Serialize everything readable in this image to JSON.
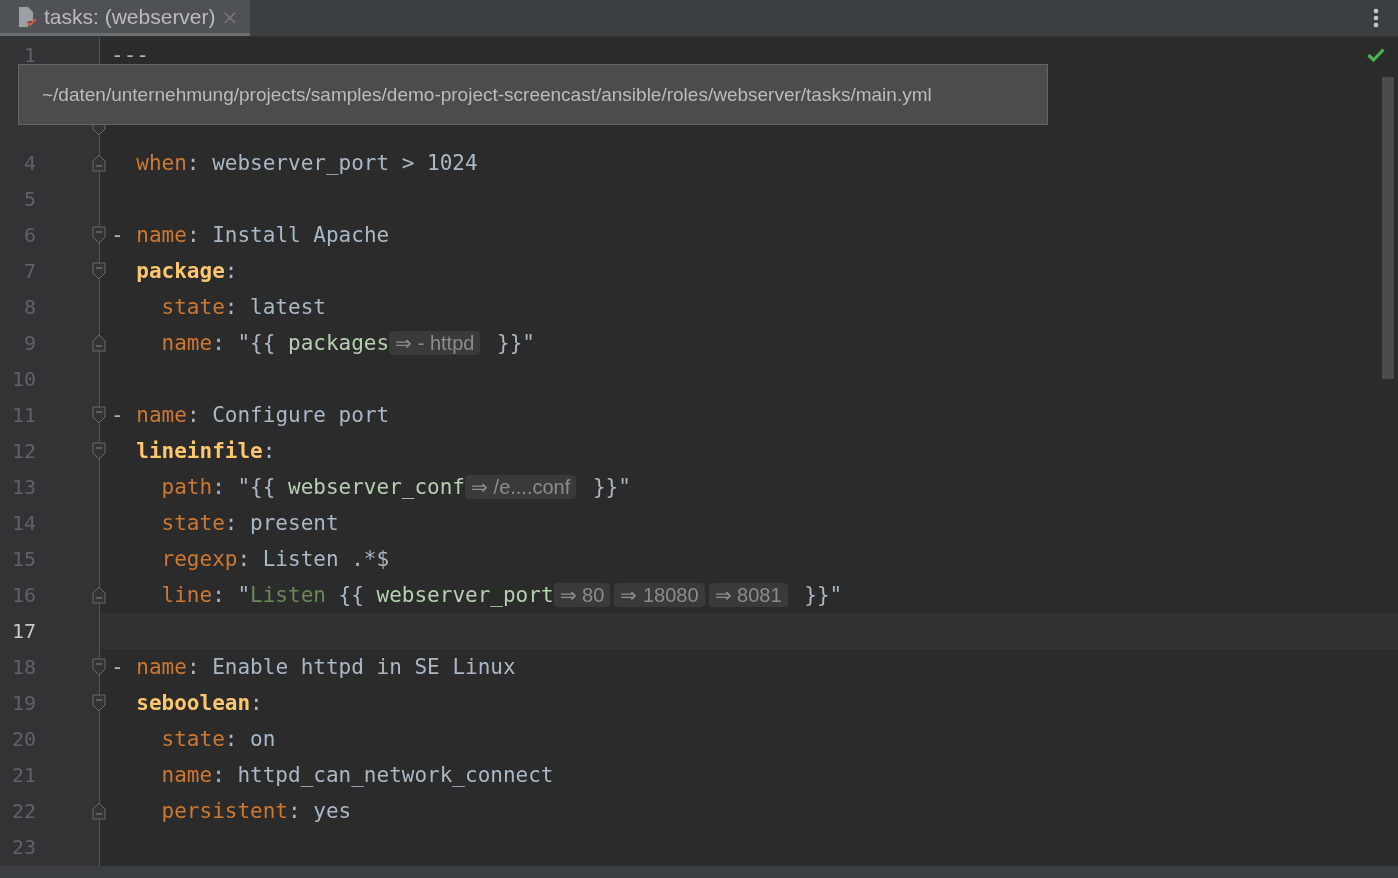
{
  "tab": {
    "title": "tasks: (webserver)",
    "close": "×",
    "selected": true
  },
  "tooltip": {
    "text": "~/daten/unternehmung/projects/samples/demo-project-screencast/ansible/roles/webserver/tasks/main.yml"
  },
  "lines": [
    {
      "number": "1",
      "current": false,
      "kind": "top",
      "tokens": [
        {
          "kind": "plain",
          "text": "---"
        }
      ]
    },
    {
      "kind": "top"
    },
    {
      "kind": "top",
      "fold_start": true
    },
    {
      "number": "4",
      "current": false,
      "kind": "item",
      "fold_end": true,
      "tokens": [
        {
          "kind": "key",
          "text": "when"
        },
        {
          "kind": "plain",
          "text": ": webserver_port > 1024"
        }
      ]
    },
    {
      "number": "5",
      "current": false,
      "kind": "top"
    },
    {
      "number": "6",
      "current": false,
      "kind": "top",
      "fold_start": true,
      "tokens": [
        {
          "kind": "plain",
          "text": "- "
        },
        {
          "kind": "key",
          "text": "name"
        },
        {
          "kind": "plain",
          "text": ": Install Apache"
        }
      ]
    },
    {
      "number": "7",
      "current": false,
      "kind": "item",
      "fold_start": true,
      "tokens": [
        {
          "kind": "section",
          "text": "package"
        },
        {
          "kind": "plain",
          "text": ":"
        }
      ]
    },
    {
      "number": "8",
      "current": false,
      "kind": "nested",
      "tokens": [
        {
          "kind": "key",
          "text": "state"
        },
        {
          "kind": "plain",
          "text": ": latest"
        }
      ]
    },
    {
      "number": "9",
      "current": false,
      "kind": "nested",
      "fold_end": true,
      "tokens": [
        {
          "kind": "key",
          "text": "name"
        },
        {
          "kind": "plain",
          "text": ": \"{{ "
        },
        {
          "kind": "var",
          "text": "packages"
        },
        {
          "kind": "hint",
          "text": "⇒ - httpd"
        },
        {
          "kind": "brace",
          "text": " }}\""
        }
      ]
    },
    {
      "number": "10",
      "current": false,
      "kind": "top"
    },
    {
      "number": "11",
      "current": false,
      "kind": "top",
      "fold_start": true,
      "tokens": [
        {
          "kind": "plain",
          "text": "- "
        },
        {
          "kind": "key",
          "text": "name"
        },
        {
          "kind": "plain",
          "text": ": Configure port"
        }
      ]
    },
    {
      "number": "12",
      "current": false,
      "kind": "item",
      "fold_start": true,
      "tokens": [
        {
          "kind": "section",
          "text": "lineinfile"
        },
        {
          "kind": "plain",
          "text": ":"
        }
      ]
    },
    {
      "number": "13",
      "current": false,
      "kind": "nested",
      "tokens": [
        {
          "kind": "key",
          "text": "path"
        },
        {
          "kind": "plain",
          "text": ": \"{{ "
        },
        {
          "kind": "var",
          "text": "webserver_conf"
        },
        {
          "kind": "hint",
          "text": "⇒ /e....conf"
        },
        {
          "kind": "brace",
          "text": " }}\""
        }
      ]
    },
    {
      "number": "14",
      "current": false,
      "kind": "nested",
      "tokens": [
        {
          "kind": "key",
          "text": "state"
        },
        {
          "kind": "plain",
          "text": ": present"
        }
      ]
    },
    {
      "number": "15",
      "current": false,
      "kind": "nested",
      "tokens": [
        {
          "kind": "key",
          "text": "regexp"
        },
        {
          "kind": "plain",
          "text": ": Listen .*$"
        }
      ]
    },
    {
      "number": "16",
      "current": false,
      "kind": "nested",
      "fold_end": true,
      "tokens": [
        {
          "kind": "key",
          "text": "line"
        },
        {
          "kind": "plain",
          "text": ": \""
        },
        {
          "kind": "string",
          "text": "Listen "
        },
        {
          "kind": "brace",
          "text": "{{ "
        },
        {
          "kind": "var",
          "text": "webserver_port"
        },
        {
          "kind": "hint",
          "text": "⇒ 80"
        },
        {
          "kind": "hint",
          "text": "⇒ 18080"
        },
        {
          "kind": "hint",
          "text": "⇒ 8081"
        },
        {
          "kind": "brace",
          "text": " }}\""
        }
      ]
    },
    {
      "number": "17",
      "current": true,
      "kind": "top"
    },
    {
      "number": "18",
      "current": false,
      "kind": "top",
      "fold_start": true,
      "tokens": [
        {
          "kind": "plain",
          "text": "- "
        },
        {
          "kind": "key",
          "text": "name"
        },
        {
          "kind": "plain",
          "text": ": Enable httpd in SE Linux"
        }
      ]
    },
    {
      "number": "19",
      "current": false,
      "kind": "item",
      "fold_start": true,
      "tokens": [
        {
          "kind": "section",
          "text": "seboolean"
        },
        {
          "kind": "plain",
          "text": ":"
        }
      ]
    },
    {
      "number": "20",
      "current": false,
      "kind": "nested",
      "tokens": [
        {
          "kind": "key",
          "text": "state"
        },
        {
          "kind": "plain",
          "text": ": on"
        }
      ]
    },
    {
      "number": "21",
      "current": false,
      "kind": "nested",
      "tokens": [
        {
          "kind": "key",
          "text": "name"
        },
        {
          "kind": "plain",
          "text": ": httpd_can_network_connect"
        }
      ]
    },
    {
      "number": "22",
      "current": false,
      "kind": "nested",
      "fold_end": true,
      "tokens": [
        {
          "kind": "key",
          "text": "persistent"
        },
        {
          "kind": "plain",
          "text": ": yes"
        }
      ]
    },
    {
      "number": "23",
      "current": false,
      "kind": "top"
    }
  ]
}
